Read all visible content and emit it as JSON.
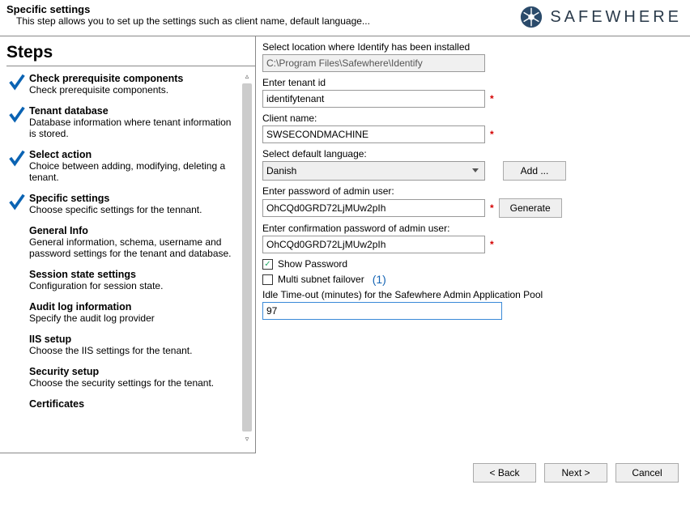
{
  "header": {
    "title": "Specific settings",
    "subtitle": "This step allows you to set up the settings such as client name, default language...",
    "brand": "SAFEWHERE"
  },
  "sidebar": {
    "title": "Steps",
    "items": [
      {
        "title": "Check prerequisite components",
        "desc": "Check prerequisite components.",
        "checked": true
      },
      {
        "title": "Tenant database",
        "desc": "Database information where tenant information is stored.",
        "checked": true
      },
      {
        "title": "Select action",
        "desc": "Choice between adding, modifying, deleting a tenant.",
        "checked": true
      },
      {
        "title": "Specific settings",
        "desc": "Choose specific settings for the tennant.",
        "checked": true
      },
      {
        "title": "General Info",
        "desc": "General information, schema, username and password settings for the tenant and database.",
        "checked": false
      },
      {
        "title": "Session state settings",
        "desc": "Configuration for session state.",
        "checked": false
      },
      {
        "title": "Audit log information",
        "desc": "Specify the audit log provider",
        "checked": false
      },
      {
        "title": "IIS setup",
        "desc": "Choose the IIS settings for the tenant.",
        "checked": false
      },
      {
        "title": "Security setup",
        "desc": "Choose the security settings for the tenant.",
        "checked": false
      },
      {
        "title": "Certificates",
        "desc": "",
        "checked": false
      }
    ]
  },
  "form": {
    "location_label": "Select location where Identify has been installed",
    "location_value": "C:\\Program Files\\Safewhere\\Identify",
    "tenant_label": "Enter tenant id",
    "tenant_value": "identifytenant",
    "client_label": "Client name:",
    "client_value": "SWSECONDMACHINE",
    "lang_label": "Select default language:",
    "lang_value": "Danish",
    "add_btn": "Add ...",
    "pwd_label": "Enter password of admin user:",
    "pwd_value": "OhCQd0GRD72LjMUw2pIh",
    "gen_btn": "Generate",
    "confirm_label": "Enter confirmation password of admin user:",
    "confirm_value": "OhCQd0GRD72LjMUw2pIh",
    "show_pwd": "Show Password",
    "multi_subnet": "Multi subnet failover",
    "annotation": "(1)",
    "idle_label": "Idle Time-out (minutes) for the Safewhere Admin Application Pool",
    "idle_value": "97"
  },
  "footer": {
    "back": "< Back",
    "next": "Next >",
    "cancel": "Cancel"
  }
}
